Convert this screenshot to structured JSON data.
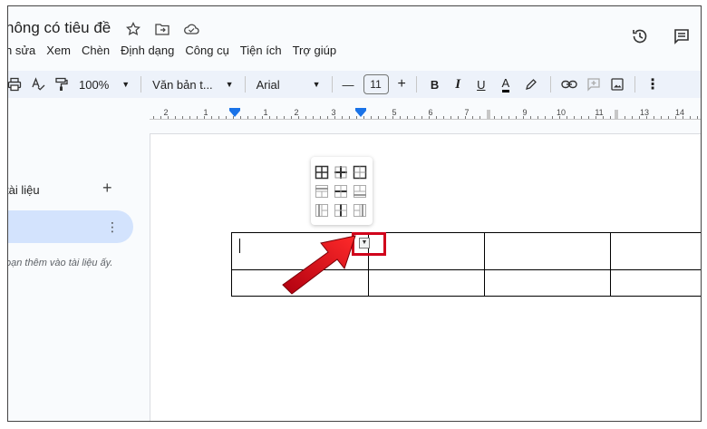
{
  "doc": {
    "title": "hông có tiêu đề"
  },
  "menu": [
    "h sửa",
    "Xem",
    "Chèn",
    "Định dạng",
    "Công cụ",
    "Tiện ích",
    "Trợ giúp"
  ],
  "toolbar": {
    "zoom": "100%",
    "style": "Văn bản t...",
    "font": "Arial",
    "font_size": "11",
    "minus": "—",
    "plus": "+",
    "bold": "B",
    "italic": "I",
    "underline": "U",
    "text_color": "A"
  },
  "ruler": {
    "numbers": [
      "2",
      "1",
      "1",
      "2",
      "3",
      "5",
      "6",
      "7",
      "9",
      "10",
      "11",
      "13",
      "14"
    ]
  },
  "sidebar": {
    "outline_title": "tài liệu",
    "add_symbol": "+",
    "more_symbol": "⋮",
    "hint": "ọạn thêm vào tài liệu ấy."
  },
  "colors": {
    "accent": "#1a73e8",
    "highlight": "#d0021b",
    "pill": "#d3e3fd",
    "toolbar": "#edf2fa"
  }
}
